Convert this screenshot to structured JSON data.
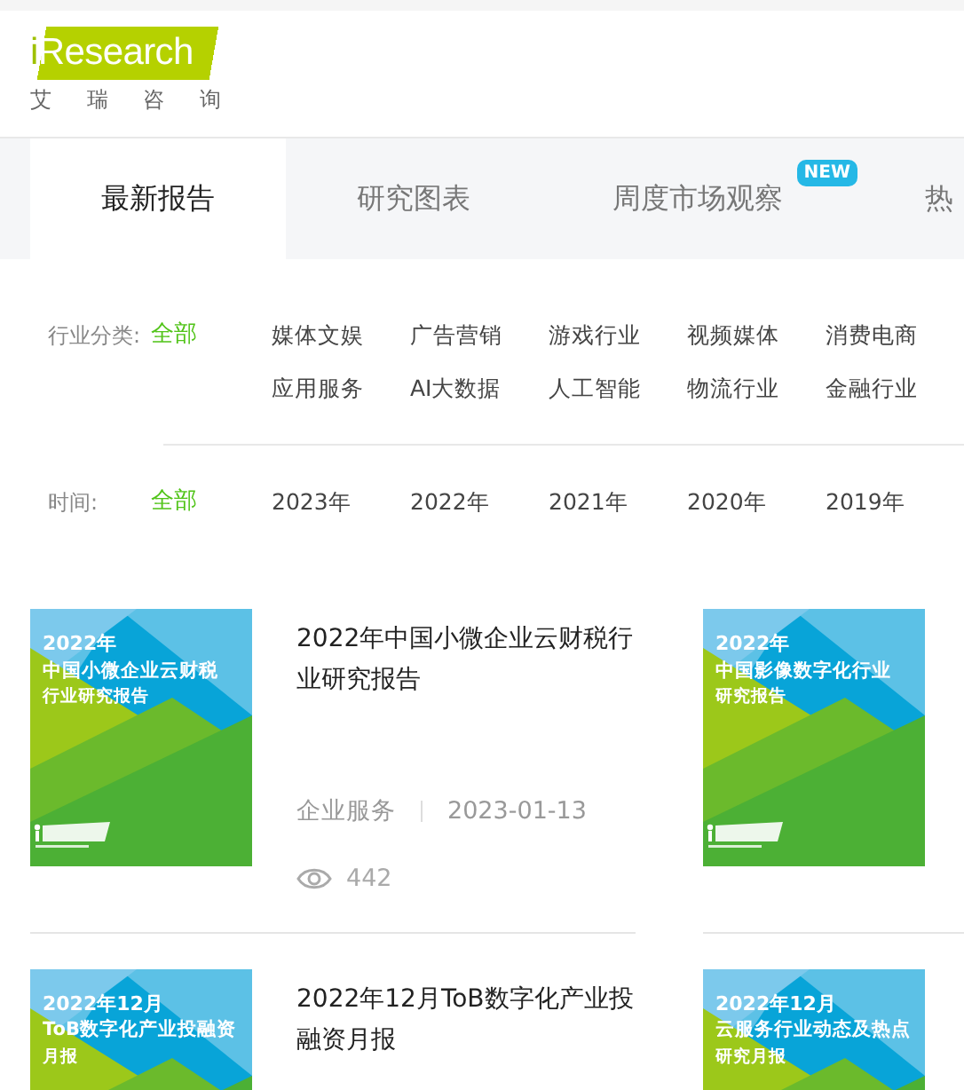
{
  "logo": {
    "brand": "iResearch",
    "subtitle": "艾 瑞 咨 询"
  },
  "tabs": [
    {
      "label": "最新报告",
      "selected": true
    },
    {
      "label": "研究图表",
      "selected": false
    },
    {
      "label": "周度市场观察",
      "selected": false,
      "badge": "NEW"
    },
    {
      "label": "热",
      "selected": false
    }
  ],
  "filters": [
    {
      "label": "行业分类:",
      "all": {
        "label": "全部",
        "selected": true
      },
      "options": [
        {
          "label": "媒体文娱",
          "selected": false
        },
        {
          "label": "广告营销",
          "selected": false
        },
        {
          "label": "游戏行业",
          "selected": false
        },
        {
          "label": "视频媒体",
          "selected": false
        },
        {
          "label": "消费电商",
          "selected": false
        },
        {
          "label": "应用服务",
          "selected": false
        },
        {
          "label": "AI大数据",
          "selected": false
        },
        {
          "label": "人工智能",
          "selected": false
        },
        {
          "label": "物流行业",
          "selected": false
        },
        {
          "label": "金融行业",
          "selected": false
        }
      ]
    },
    {
      "label": "时间:",
      "all": {
        "label": "全部",
        "selected": true
      },
      "options": [
        {
          "label": "2023年",
          "selected": false
        },
        {
          "label": "2022年",
          "selected": false
        },
        {
          "label": "2021年",
          "selected": false
        },
        {
          "label": "2020年",
          "selected": false
        },
        {
          "label": "2019年",
          "selected": false
        }
      ]
    }
  ],
  "reports": [
    {
      "cover": [
        "2022年",
        "中国小微企业云财税",
        "行业研究报告"
      ],
      "cover_logo": true,
      "title": "2022年中国小微企业云财税行业研究报告",
      "category": "企业服务",
      "date": "2023-01-13",
      "views": "442"
    },
    {
      "cover": [
        "2022年",
        "中国影像数字化行业",
        "研究报告"
      ],
      "cover_logo": true
    },
    {
      "cover": [
        "2022年12月",
        "ToB数字化产业投融资",
        "月报"
      ],
      "title": "2022年12月ToB数字化产业投融资月报"
    },
    {
      "cover": [
        "2022年12月",
        "云服务行业动态及热点",
        "研究月报"
      ]
    }
  ]
}
